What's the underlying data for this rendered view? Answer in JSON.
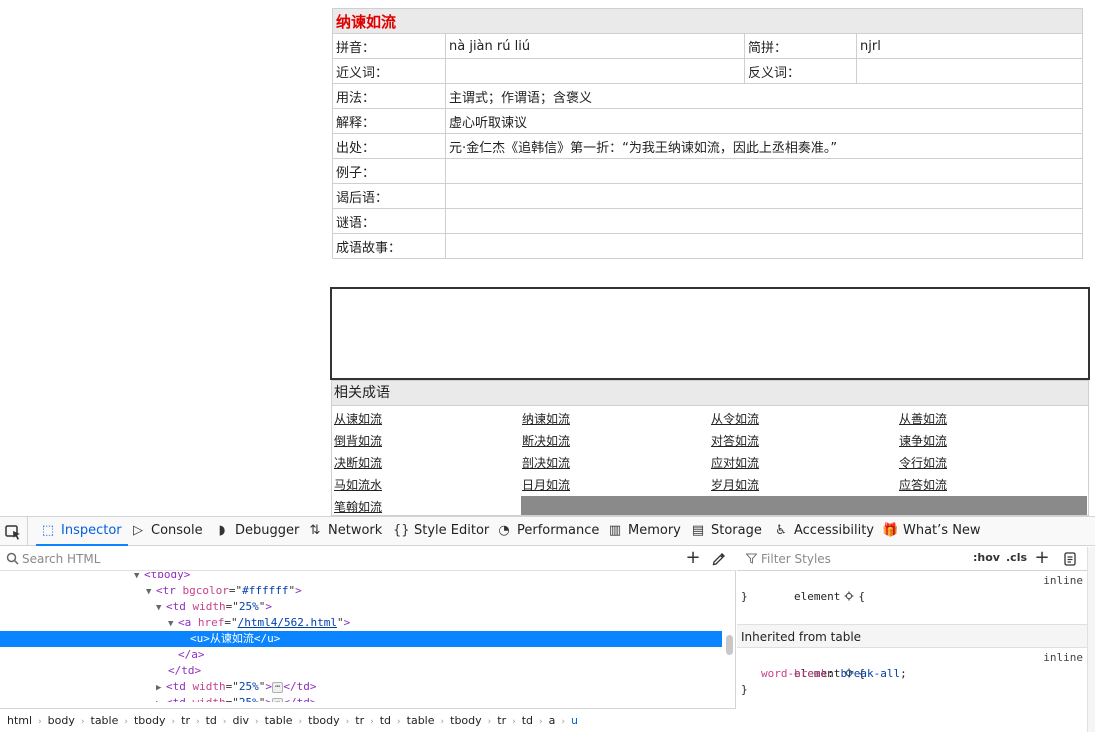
{
  "idiom": {
    "title": "纳谏如流",
    "pinyin_label": "拼音：",
    "pinyin": "nà jiàn rú liú",
    "abbr_label": "简拼：",
    "abbr": "njrl",
    "synonym_label": "近义词：",
    "synonym": "",
    "antonym_label": "反义词：",
    "antonym": "",
    "usage_label": "用法：",
    "usage": "主谓式；作谓语；含褒义",
    "meaning_label": "解释：",
    "meaning": "虚心听取谏议",
    "source_label": "出处：",
    "source": "元·金仁杰《追韩信》第一折：“为我王纳谏如流，因此上丞相奏准。”",
    "example_label": "例子：",
    "example": "",
    "xiehouyu_label": "谒后语：",
    "xiehouyu": "",
    "riddle_label": "谜语：",
    "riddle": "",
    "story_label": "成语故事：",
    "story": ""
  },
  "related": {
    "heading": "相关成语",
    "links": [
      "从谏如流",
      "纳谏如流",
      "从令如流",
      "从善如流",
      "倒背如流",
      "断决如流",
      "对答如流",
      "谏争如流",
      "决断如流",
      "剖决如流",
      "应对如流",
      "令行如流",
      "马如流水",
      "日月如流",
      "岁月如流",
      "应答如流",
      "笔翰如流"
    ]
  },
  "devtools": {
    "tabs": [
      {
        "label": "Inspector",
        "icon": "inspector-icon",
        "glyph": "⬚"
      },
      {
        "label": "Console",
        "icon": "console-icon",
        "glyph": "▷"
      },
      {
        "label": "Debugger",
        "icon": "debugger-icon",
        "glyph": "◗"
      },
      {
        "label": "Network",
        "icon": "network-icon",
        "glyph": "⇅"
      },
      {
        "label": "Style Editor",
        "icon": "style-editor-icon",
        "glyph": "{}"
      },
      {
        "label": "Performance",
        "icon": "performance-icon",
        "glyph": "◔"
      },
      {
        "label": "Memory",
        "icon": "memory-icon",
        "glyph": "▥"
      },
      {
        "label": "Storage",
        "icon": "storage-icon",
        "glyph": "▤"
      },
      {
        "label": "Accessibility",
        "icon": "accessibility-icon",
        "glyph": "♿"
      },
      {
        "label": "What’s New",
        "icon": "gift-icon",
        "glyph": "🎁"
      }
    ],
    "search_placeholder": "Search HTML",
    "tree": [
      {
        "twisty": "▼",
        "tag": "tbody",
        "attrs": [],
        "tail": ""
      },
      {
        "twisty": "▼",
        "tag": "tr",
        "attrs": [
          [
            "bgcolor",
            "#ffffff"
          ]
        ],
        "tail": ""
      },
      {
        "twisty": "▼",
        "tag": "td",
        "attrs": [
          [
            "width",
            "25%"
          ]
        ],
        "tail": ""
      },
      {
        "twisty": "▼",
        "tag": "a",
        "attrs": [
          [
            "href",
            "/html4/562.html"
          ]
        ],
        "tail": ""
      },
      {
        "twisty": "",
        "raw": "<u>从谏如流</u>",
        "selected": true
      },
      {
        "twisty": "",
        "raw": "</a>"
      },
      {
        "twisty": "",
        "raw": "</td>"
      },
      {
        "twisty": "▶",
        "tag": "td",
        "attrs": [
          [
            "width",
            "25%"
          ]
        ],
        "tail": "</td>",
        "collapsed": true
      },
      {
        "twisty": "▶",
        "tag": "td",
        "attrs": [
          [
            "width",
            "25%"
          ]
        ],
        "tail": "</td>",
        "collapsed": true
      }
    ],
    "breadcrumbs": [
      "html",
      "body",
      "table",
      "tbody",
      "tr",
      "td",
      "div",
      "table",
      "tbody",
      "tr",
      "td",
      "table",
      "tbody",
      "tr",
      "td",
      "a",
      "u"
    ],
    "filter_placeholder": "Filter Styles",
    "hov_label": ":hov",
    "cls_label": ".cls",
    "rule1_selector": "element",
    "rule1_source": "inline",
    "inherited_label": "Inherited from table",
    "rule2_selector": "element",
    "rule2_source": "inline",
    "rule2_prop": "word-break",
    "rule2_value": "break-all"
  }
}
